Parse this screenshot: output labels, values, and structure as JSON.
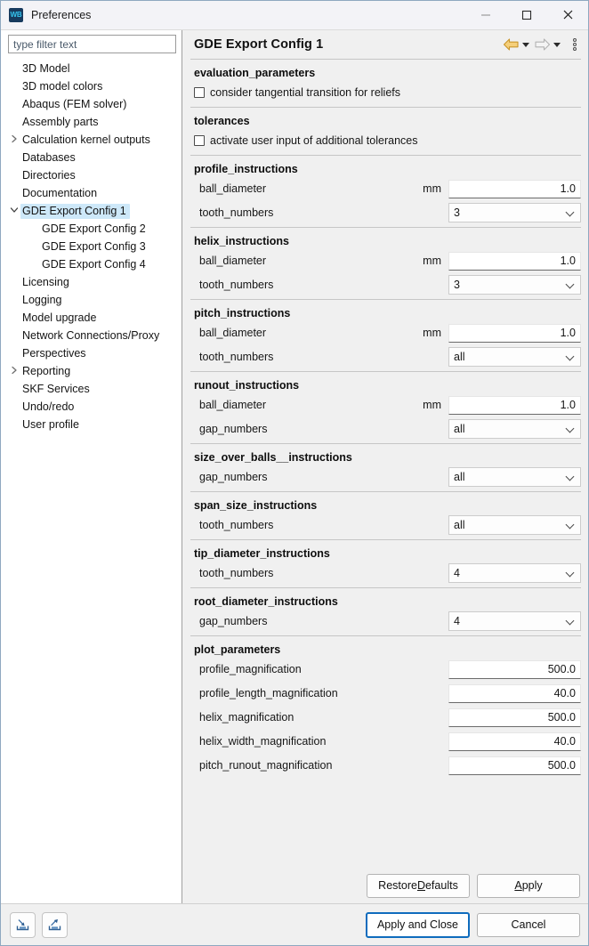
{
  "window": {
    "title": "Preferences",
    "app_icon_text": "WB",
    "minimize_label": "Minimize",
    "maximize_label": "Maximize",
    "close_label": "Close"
  },
  "search": {
    "placeholder": "type filter text",
    "value": ""
  },
  "tree": {
    "items": [
      {
        "label": "3D Model",
        "indent": 1,
        "twisty": "",
        "selected": false
      },
      {
        "label": "3D model colors",
        "indent": 1,
        "twisty": "",
        "selected": false
      },
      {
        "label": "Abaqus (FEM solver)",
        "indent": 1,
        "twisty": "",
        "selected": false
      },
      {
        "label": "Assembly parts",
        "indent": 1,
        "twisty": "",
        "selected": false
      },
      {
        "label": "Calculation kernel outputs",
        "indent": 1,
        "twisty": "collapsed",
        "selected": false
      },
      {
        "label": "Databases",
        "indent": 1,
        "twisty": "",
        "selected": false
      },
      {
        "label": "Directories",
        "indent": 1,
        "twisty": "",
        "selected": false
      },
      {
        "label": "Documentation",
        "indent": 1,
        "twisty": "",
        "selected": false
      },
      {
        "label": "GDE Export Config 1",
        "indent": 1,
        "twisty": "expanded",
        "selected": true
      },
      {
        "label": "GDE Export Config 2",
        "indent": 2,
        "twisty": "",
        "selected": false
      },
      {
        "label": "GDE Export Config 3",
        "indent": 2,
        "twisty": "",
        "selected": false
      },
      {
        "label": "GDE Export Config 4",
        "indent": 2,
        "twisty": "",
        "selected": false
      },
      {
        "label": "Licensing",
        "indent": 1,
        "twisty": "",
        "selected": false
      },
      {
        "label": "Logging",
        "indent": 1,
        "twisty": "",
        "selected": false
      },
      {
        "label": "Model upgrade",
        "indent": 1,
        "twisty": "",
        "selected": false
      },
      {
        "label": "Network Connections/Proxy",
        "indent": 1,
        "twisty": "",
        "selected": false
      },
      {
        "label": "Perspectives",
        "indent": 1,
        "twisty": "",
        "selected": false
      },
      {
        "label": "Reporting",
        "indent": 1,
        "twisty": "collapsed",
        "selected": false
      },
      {
        "label": "SKF Services",
        "indent": 1,
        "twisty": "",
        "selected": false
      },
      {
        "label": "Undo/redo",
        "indent": 1,
        "twisty": "",
        "selected": false
      },
      {
        "label": "User profile",
        "indent": 1,
        "twisty": "",
        "selected": false
      }
    ]
  },
  "page": {
    "title": "GDE Export Config 1",
    "nav": {
      "back_label": "Back",
      "forward_label": "Forward",
      "menu_label": "View Menu"
    },
    "groups": [
      {
        "title": "evaluation_parameters",
        "checkboxes": [
          {
            "label": "consider tangential transition for reliefs",
            "checked": false
          }
        ],
        "fields": []
      },
      {
        "title": "tolerances",
        "checkboxes": [
          {
            "label": "activate user input of additional tolerances",
            "checked": false
          }
        ],
        "fields": []
      },
      {
        "title": "profile_instructions",
        "checkboxes": [],
        "fields": [
          {
            "label": "ball_diameter",
            "unit": "mm",
            "type": "text",
            "value": "1.0"
          },
          {
            "label": "tooth_numbers",
            "unit": "",
            "type": "combo",
            "value": "3"
          }
        ]
      },
      {
        "title": "helix_instructions",
        "checkboxes": [],
        "fields": [
          {
            "label": "ball_diameter",
            "unit": "mm",
            "type": "text",
            "value": "1.0"
          },
          {
            "label": "tooth_numbers",
            "unit": "",
            "type": "combo",
            "value": "3"
          }
        ]
      },
      {
        "title": "pitch_instructions",
        "checkboxes": [],
        "fields": [
          {
            "label": "ball_diameter",
            "unit": "mm",
            "type": "text",
            "value": "1.0"
          },
          {
            "label": "tooth_numbers",
            "unit": "",
            "type": "combo",
            "value": "all"
          }
        ]
      },
      {
        "title": "runout_instructions",
        "checkboxes": [],
        "fields": [
          {
            "label": "ball_diameter",
            "unit": "mm",
            "type": "text",
            "value": "1.0"
          },
          {
            "label": "gap_numbers",
            "unit": "",
            "type": "combo",
            "value": "all"
          }
        ]
      },
      {
        "title": "size_over_balls__instructions",
        "checkboxes": [],
        "fields": [
          {
            "label": "gap_numbers",
            "unit": "",
            "type": "combo",
            "value": "all"
          }
        ]
      },
      {
        "title": "span_size_instructions",
        "checkboxes": [],
        "fields": [
          {
            "label": "tooth_numbers",
            "unit": "",
            "type": "combo",
            "value": "all"
          }
        ]
      },
      {
        "title": "tip_diameter_instructions",
        "checkboxes": [],
        "fields": [
          {
            "label": "tooth_numbers",
            "unit": "",
            "type": "combo",
            "value": "4"
          }
        ]
      },
      {
        "title": "root_diameter_instructions",
        "checkboxes": [],
        "fields": [
          {
            "label": "gap_numbers",
            "unit": "",
            "type": "combo",
            "value": "4"
          }
        ]
      },
      {
        "title": "plot_parameters",
        "checkboxes": [],
        "fields": [
          {
            "label": "profile_magnification",
            "unit": "",
            "type": "text",
            "value": "500.0"
          },
          {
            "label": "profile_length_magnification",
            "unit": "",
            "type": "text",
            "value": "40.0"
          },
          {
            "label": "helix_magnification",
            "unit": "",
            "type": "text",
            "value": "500.0"
          },
          {
            "label": "helix_width_magnification",
            "unit": "",
            "type": "text",
            "value": "40.0"
          },
          {
            "label": "pitch_runout_magnification",
            "unit": "",
            "type": "text",
            "value": "500.0"
          }
        ]
      }
    ]
  },
  "apply_bar": {
    "restore_defaults_pre": "Restore ",
    "restore_defaults_key": "D",
    "restore_defaults_post": "efaults",
    "apply_key": "A",
    "apply_post": "pply"
  },
  "bottom_bar": {
    "import_label": "Import Preferences",
    "export_label": "Export Preferences",
    "apply_and_close_label": "Apply and Close",
    "cancel_label": "Cancel"
  },
  "colors": {
    "selection": "#cde8f9",
    "default_button_border": "#0f6cbd",
    "back_arrow": "#e8a33d",
    "forward_arrow": "#b8b8b8",
    "app_icon_bg": "#173a5e",
    "app_icon_fg": "#35c5f0"
  }
}
